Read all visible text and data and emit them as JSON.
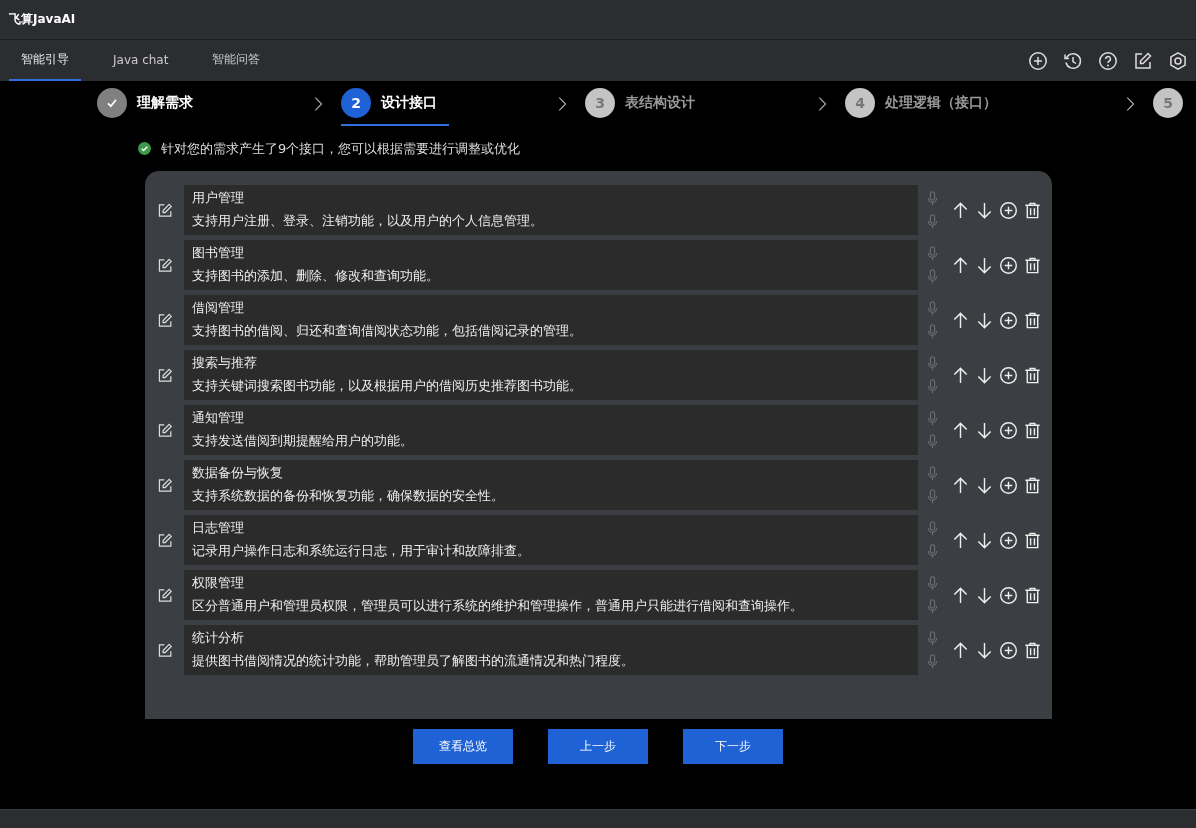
{
  "app_title": "飞算JavaAI",
  "tabs": [
    {
      "label": "智能引导",
      "selected": true
    },
    {
      "label": "Java chat",
      "selected": false
    },
    {
      "label": "智能问答",
      "selected": false
    }
  ],
  "steps": [
    {
      "label": "理解需求",
      "completed": true,
      "selected": false
    },
    {
      "number": "2",
      "label": "设计接口",
      "completed": false,
      "selected": true
    },
    {
      "number": "3",
      "label": "表结构设计",
      "completed": false,
      "selected": false
    },
    {
      "number": "4",
      "label": "处理逻辑（接口）",
      "completed": false,
      "selected": false
    },
    {
      "number": "5",
      "completed": false,
      "selected": false
    }
  ],
  "notice": "针对您的需求产生了9个接口，您可以根据需要进行调整或优化",
  "interfaces": [
    {
      "name": "用户管理",
      "description": "支持用户注册、登录、注销功能，以及用户的个人信息管理。"
    },
    {
      "name": "图书管理",
      "description": "支持图书的添加、删除、修改和查询功能。"
    },
    {
      "name": "借阅管理",
      "description": "支持图书的借阅、归还和查询借阅状态功能，包括借阅记录的管理。"
    },
    {
      "name": "搜索与推荐",
      "description": "支持关键词搜索图书功能，以及根据用户的借阅历史推荐图书功能。"
    },
    {
      "name": "通知管理",
      "description": "支持发送借阅到期提醒给用户的功能。"
    },
    {
      "name": "数据备份与恢复",
      "description": "支持系统数据的备份和恢复功能，确保数据的安全性。"
    },
    {
      "name": "日志管理",
      "description": "记录用户操作日志和系统运行日志，用于审计和故障排查。"
    },
    {
      "name": "权限管理",
      "description": "区分普通用户和管理员权限，管理员可以进行系统的维护和管理操作，普通用户只能进行借阅和查询操作。"
    },
    {
      "name": "统计分析",
      "description": "提供图书借阅情况的统计功能，帮助管理员了解图书的流通情况和热门程度。"
    }
  ],
  "buttons": [
    "查看总览",
    "上一步",
    "下一步"
  ]
}
